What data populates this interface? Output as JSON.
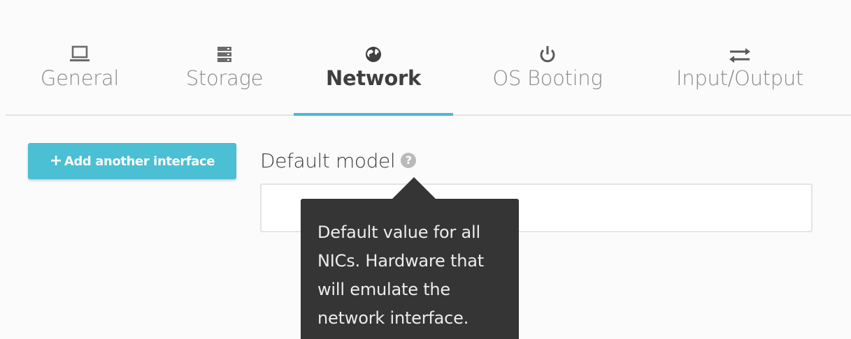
{
  "tabs": [
    {
      "label": "General",
      "icon": "laptop-icon",
      "active": false
    },
    {
      "label": "Storage",
      "icon": "storage-icon",
      "active": false
    },
    {
      "label": "Network",
      "icon": "globe-icon",
      "active": true
    },
    {
      "label": "OS Booting",
      "icon": "power-icon",
      "active": false
    },
    {
      "label": "Input/Output",
      "icon": "exchange-icon",
      "active": false
    }
  ],
  "actions": {
    "add_interface_label": "Add another interface",
    "add_interface_icon": "plus-icon"
  },
  "default_model": {
    "label": "Default model",
    "help_icon": "question-circle-icon",
    "value": "",
    "tooltip": "Default value for all NICs. Hardware that will emulate the network interface."
  },
  "colors": {
    "accent": "#4bb9d2",
    "button": "#4bbfd3",
    "tooltip_bg": "#353535"
  }
}
